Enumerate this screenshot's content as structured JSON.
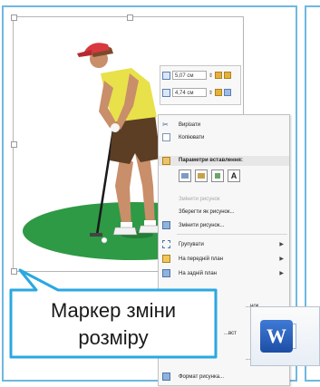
{
  "size_toolbar": {
    "height_value": "5,07 см",
    "width_value": "4,74 см"
  },
  "context_menu": {
    "items": [
      {
        "label": "Вирізати",
        "disabled": false,
        "submenu": false
      },
      {
        "label": "Копіювати",
        "disabled": false,
        "submenu": false
      }
    ],
    "paste_header": "Параметри вставлення:",
    "paste_letter": "A",
    "items_after_paste": [
      {
        "label": "Змінити рисунок",
        "disabled": true,
        "submenu": false
      },
      {
        "label": "Зберегти як рисунок...",
        "disabled": false,
        "submenu": false
      },
      {
        "label": "Змінити рисунок...",
        "disabled": false,
        "submenu": false
      },
      {
        "label": "Групувати",
        "disabled": false,
        "submenu": true
      },
      {
        "label": "На передній план",
        "disabled": false,
        "submenu": true
      },
      {
        "label": "На задній план",
        "disabled": false,
        "submenu": true
      },
      {
        "label": "...нок...",
        "disabled": false,
        "submenu": false
      },
      {
        "label": "...вст",
        "disabled": false,
        "submenu": false
      },
      {
        "label": "...нку...",
        "disabled": false,
        "submenu": false
      },
      {
        "label": "Формат рисунка...",
        "disabled": false,
        "submenu": false
      }
    ]
  },
  "callout": {
    "line1": "Маркер зміни",
    "line2": "розміру"
  },
  "word_icon": {
    "letter": "W"
  },
  "colors": {
    "pane_border": "#6fb8e0",
    "callout_border": "#2aa8e0",
    "green": "#2e9a45",
    "shirt": "#e8e14a",
    "cap": "#d8383f"
  }
}
